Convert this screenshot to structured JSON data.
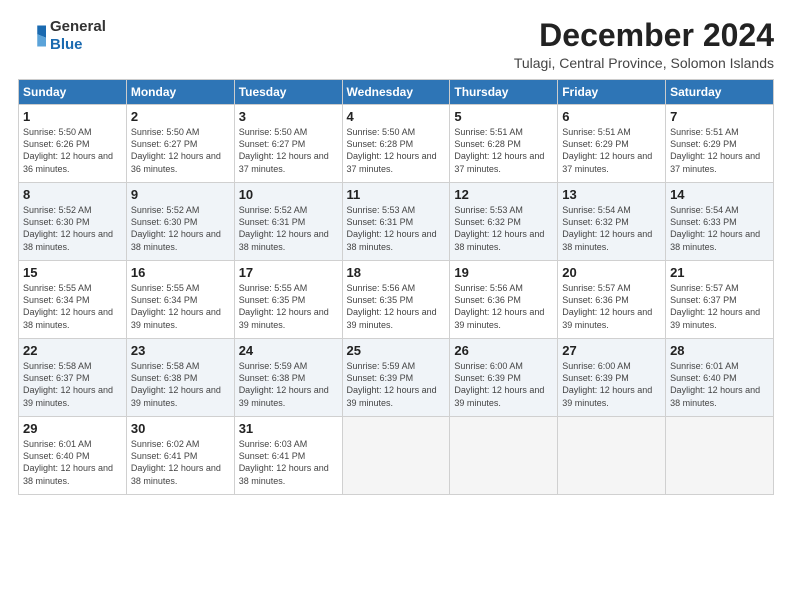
{
  "header": {
    "logo_line1": "General",
    "logo_line2": "Blue",
    "month_title": "December 2024",
    "location": "Tulagi, Central Province, Solomon Islands"
  },
  "weekdays": [
    "Sunday",
    "Monday",
    "Tuesday",
    "Wednesday",
    "Thursday",
    "Friday",
    "Saturday"
  ],
  "weeks": [
    [
      {
        "day": "1",
        "sunrise": "5:50 AM",
        "sunset": "6:26 PM",
        "daylight": "12 hours and 36 minutes."
      },
      {
        "day": "2",
        "sunrise": "5:50 AM",
        "sunset": "6:27 PM",
        "daylight": "12 hours and 36 minutes."
      },
      {
        "day": "3",
        "sunrise": "5:50 AM",
        "sunset": "6:27 PM",
        "daylight": "12 hours and 37 minutes."
      },
      {
        "day": "4",
        "sunrise": "5:50 AM",
        "sunset": "6:28 PM",
        "daylight": "12 hours and 37 minutes."
      },
      {
        "day": "5",
        "sunrise": "5:51 AM",
        "sunset": "6:28 PM",
        "daylight": "12 hours and 37 minutes."
      },
      {
        "day": "6",
        "sunrise": "5:51 AM",
        "sunset": "6:29 PM",
        "daylight": "12 hours and 37 minutes."
      },
      {
        "day": "7",
        "sunrise": "5:51 AM",
        "sunset": "6:29 PM",
        "daylight": "12 hours and 37 minutes."
      }
    ],
    [
      {
        "day": "8",
        "sunrise": "5:52 AM",
        "sunset": "6:30 PM",
        "daylight": "12 hours and 38 minutes."
      },
      {
        "day": "9",
        "sunrise": "5:52 AM",
        "sunset": "6:30 PM",
        "daylight": "12 hours and 38 minutes."
      },
      {
        "day": "10",
        "sunrise": "5:52 AM",
        "sunset": "6:31 PM",
        "daylight": "12 hours and 38 minutes."
      },
      {
        "day": "11",
        "sunrise": "5:53 AM",
        "sunset": "6:31 PM",
        "daylight": "12 hours and 38 minutes."
      },
      {
        "day": "12",
        "sunrise": "5:53 AM",
        "sunset": "6:32 PM",
        "daylight": "12 hours and 38 minutes."
      },
      {
        "day": "13",
        "sunrise": "5:54 AM",
        "sunset": "6:32 PM",
        "daylight": "12 hours and 38 minutes."
      },
      {
        "day": "14",
        "sunrise": "5:54 AM",
        "sunset": "6:33 PM",
        "daylight": "12 hours and 38 minutes."
      }
    ],
    [
      {
        "day": "15",
        "sunrise": "5:55 AM",
        "sunset": "6:34 PM",
        "daylight": "12 hours and 38 minutes."
      },
      {
        "day": "16",
        "sunrise": "5:55 AM",
        "sunset": "6:34 PM",
        "daylight": "12 hours and 39 minutes."
      },
      {
        "day": "17",
        "sunrise": "5:55 AM",
        "sunset": "6:35 PM",
        "daylight": "12 hours and 39 minutes."
      },
      {
        "day": "18",
        "sunrise": "5:56 AM",
        "sunset": "6:35 PM",
        "daylight": "12 hours and 39 minutes."
      },
      {
        "day": "19",
        "sunrise": "5:56 AM",
        "sunset": "6:36 PM",
        "daylight": "12 hours and 39 minutes."
      },
      {
        "day": "20",
        "sunrise": "5:57 AM",
        "sunset": "6:36 PM",
        "daylight": "12 hours and 39 minutes."
      },
      {
        "day": "21",
        "sunrise": "5:57 AM",
        "sunset": "6:37 PM",
        "daylight": "12 hours and 39 minutes."
      }
    ],
    [
      {
        "day": "22",
        "sunrise": "5:58 AM",
        "sunset": "6:37 PM",
        "daylight": "12 hours and 39 minutes."
      },
      {
        "day": "23",
        "sunrise": "5:58 AM",
        "sunset": "6:38 PM",
        "daylight": "12 hours and 39 minutes."
      },
      {
        "day": "24",
        "sunrise": "5:59 AM",
        "sunset": "6:38 PM",
        "daylight": "12 hours and 39 minutes."
      },
      {
        "day": "25",
        "sunrise": "5:59 AM",
        "sunset": "6:39 PM",
        "daylight": "12 hours and 39 minutes."
      },
      {
        "day": "26",
        "sunrise": "6:00 AM",
        "sunset": "6:39 PM",
        "daylight": "12 hours and 39 minutes."
      },
      {
        "day": "27",
        "sunrise": "6:00 AM",
        "sunset": "6:39 PM",
        "daylight": "12 hours and 39 minutes."
      },
      {
        "day": "28",
        "sunrise": "6:01 AM",
        "sunset": "6:40 PM",
        "daylight": "12 hours and 38 minutes."
      }
    ],
    [
      {
        "day": "29",
        "sunrise": "6:01 AM",
        "sunset": "6:40 PM",
        "daylight": "12 hours and 38 minutes."
      },
      {
        "day": "30",
        "sunrise": "6:02 AM",
        "sunset": "6:41 PM",
        "daylight": "12 hours and 38 minutes."
      },
      {
        "day": "31",
        "sunrise": "6:03 AM",
        "sunset": "6:41 PM",
        "daylight": "12 hours and 38 minutes."
      },
      null,
      null,
      null,
      null
    ]
  ]
}
